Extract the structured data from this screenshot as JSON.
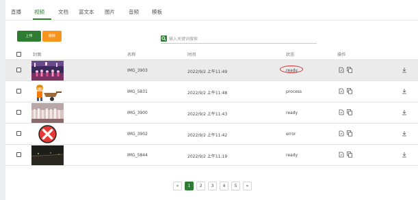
{
  "tabs": [
    {
      "label": "直播"
    },
    {
      "label": "视频"
    },
    {
      "label": "文档"
    },
    {
      "label": "富文本"
    },
    {
      "label": "图片"
    },
    {
      "label": "音频"
    },
    {
      "label": "模板"
    }
  ],
  "active_tab": "视频",
  "toolbar": {
    "upload_label": "上传",
    "delete_label": "删除"
  },
  "search": {
    "placeholder": "输入关键词搜索",
    "value": ""
  },
  "table": {
    "headers": {
      "cover": "封面",
      "name": "名称",
      "time": "时间",
      "status": "状态",
      "actions": "操作"
    },
    "rows": [
      {
        "name": "IMG_3903",
        "time": "2022/9/2 上午11:49",
        "status": "ready",
        "cover": "stage-performance",
        "highlighted": true,
        "status_circled": true
      },
      {
        "name": "IMG_5831",
        "time": "2022/9/2 上午11:48",
        "status": "process",
        "cover": "worker-with-wheelbarrow",
        "highlighted": false,
        "status_circled": false
      },
      {
        "name": "IMG_3900",
        "time": "2022/9/2 上午11:43",
        "status": "ready",
        "cover": "dancers-on-stage",
        "highlighted": false,
        "status_circled": false
      },
      {
        "name": "IMG_3902",
        "time": "2022/9/2 上午11:42",
        "status": "error",
        "cover": "error-x-icon",
        "highlighted": false,
        "status_circled": false
      },
      {
        "name": "IMG_5844",
        "time": "2022/9/2 上午11:19",
        "status": "ready",
        "cover": "dark-night-scene",
        "highlighted": false,
        "status_circled": false
      }
    ]
  },
  "pagination": {
    "prev": "«",
    "pages": [
      "1",
      "2",
      "3",
      "4",
      "5"
    ],
    "next": "»",
    "current": "1"
  },
  "colors": {
    "accent": "#2e7d32",
    "delete_button": "#f7941d",
    "status_circle": "#d32f2f",
    "error_icon": "#e53935"
  }
}
